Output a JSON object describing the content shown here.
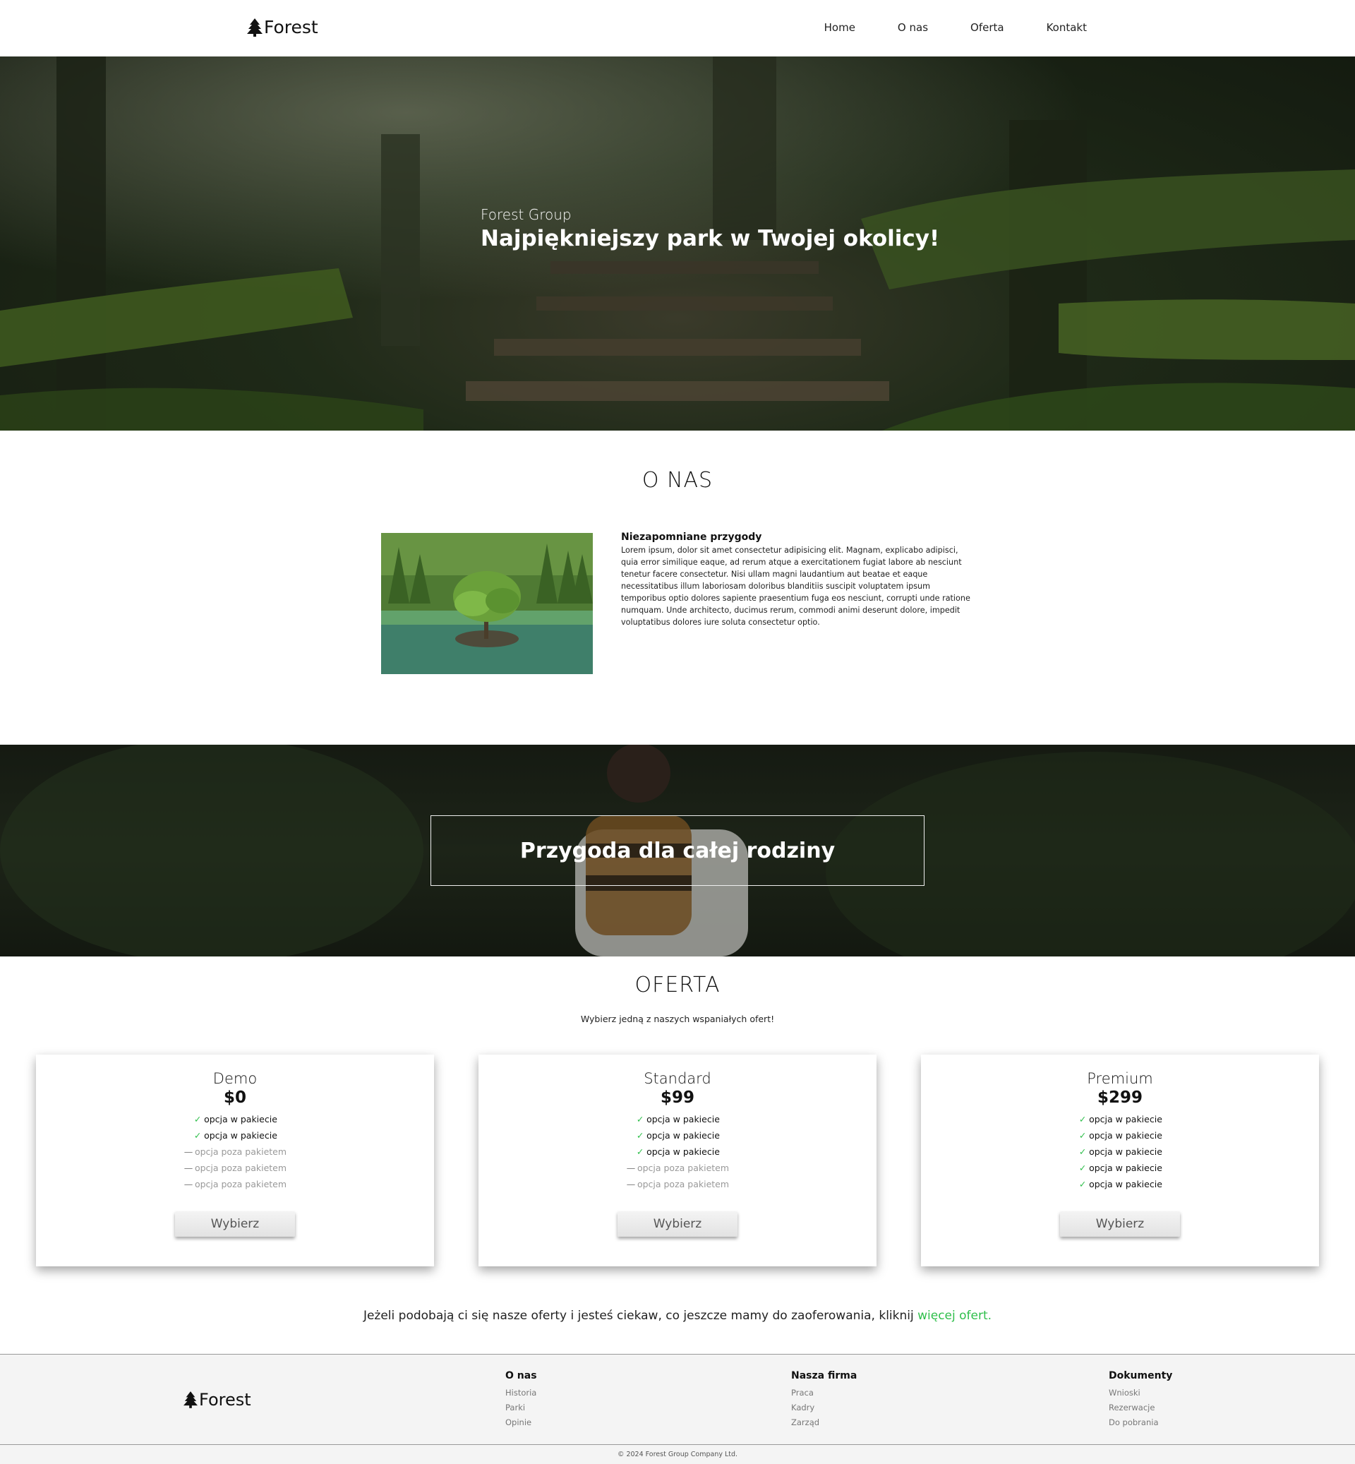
{
  "nav": {
    "logo": "Forest",
    "links": [
      "Home",
      "O nas",
      "Oferta",
      "Kontakt"
    ]
  },
  "hero": {
    "subtitle": "Forest Group",
    "title": "Najpiękniejszy park w Twojej okolicy!"
  },
  "about": {
    "title": "O NAS",
    "heading": "Niezapomniane przygody",
    "body": "Lorem ipsum, dolor sit amet consectetur adipisicing elit. Magnam, explicabo adipisci, quia error similique eaque, ad rerum atque a exercitationem fugiat labore ab nesciunt tenetur facere consectetur. Nisi ullam magni laudantium aut beatae et eaque necessitatibus illum laboriosam doloribus blanditiis suscipit voluptatem ipsum temporibus optio dolores sapiente praesentium fuga eos nesciunt, corrupti unde ratione numquam. Unde architecto, ducimus rerum, commodi animi deserunt dolore, impedit voluptatibus dolores iure soluta consectetur optio."
  },
  "banner": {
    "title": "Przygoda dla całej rodziny"
  },
  "offer": {
    "title": "OFERTA",
    "subtitle": "Wybierz jedną z naszych wspaniałych ofert!",
    "plans": [
      {
        "name": "Demo",
        "price": "$0",
        "features": [
          {
            "text": "opcja w pakiecie",
            "included": true
          },
          {
            "text": "opcja w pakiecie",
            "included": true
          },
          {
            "text": "opcja poza pakietem",
            "included": false
          },
          {
            "text": "opcja poza pakietem",
            "included": false
          },
          {
            "text": "opcja poza pakietem",
            "included": false
          }
        ],
        "button": "Wybierz"
      },
      {
        "name": "Standard",
        "price": "$99",
        "features": [
          {
            "text": "opcja w pakiecie",
            "included": true
          },
          {
            "text": "opcja w pakiecie",
            "included": true
          },
          {
            "text": "opcja w pakiecie",
            "included": true
          },
          {
            "text": "opcja poza pakietem",
            "included": false
          },
          {
            "text": "opcja poza pakietem",
            "included": false
          }
        ],
        "button": "Wybierz"
      },
      {
        "name": "Premium",
        "price": "$299",
        "features": [
          {
            "text": "opcja w pakiecie",
            "included": true
          },
          {
            "text": "opcja w pakiecie",
            "included": true
          },
          {
            "text": "opcja w pakiecie",
            "included": true
          },
          {
            "text": "opcja w pakiecie",
            "included": true
          },
          {
            "text": "opcja w pakiecie",
            "included": true
          }
        ],
        "button": "Wybierz"
      }
    ],
    "more_text": "Jeżeli podobają ci się nasze oferty i jesteś ciekaw, co jeszcze mamy do zaoferowania, kliknij ",
    "more_link": "więcej ofert."
  },
  "footer": {
    "logo": "Forest",
    "columns": [
      {
        "title": "O nas",
        "links": [
          "Historia",
          "Parki",
          "Opinie"
        ]
      },
      {
        "title": "Nasza firma",
        "links": [
          "Praca",
          "Kadry",
          "Zarząd"
        ]
      },
      {
        "title": "Dokumenty",
        "links": [
          "Wnioski",
          "Rezerwacje",
          "Do pobrania"
        ]
      }
    ],
    "copyright": "© 2024 Forest Group Company Ltd."
  },
  "colors": {
    "accent": "#2fbf4b",
    "included_check": "#2fbf4b",
    "excluded_dash": "#777777"
  },
  "icons": {
    "logo": "tree-icon",
    "included": "check-icon",
    "excluded": "dash-icon"
  }
}
